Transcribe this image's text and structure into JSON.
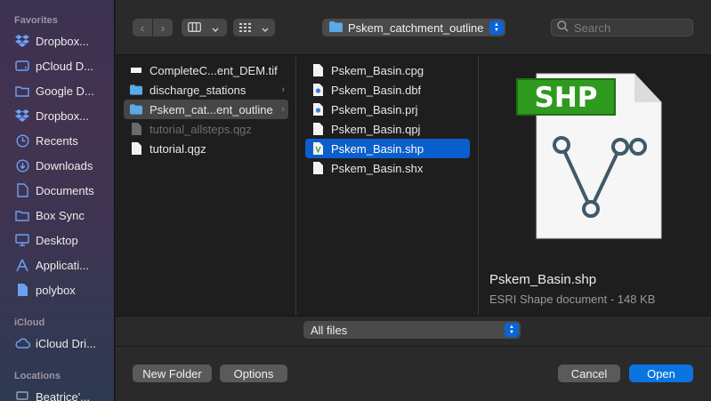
{
  "sidebar": {
    "sections": {
      "favorites": "Favorites",
      "icloud": "iCloud",
      "locations": "Locations"
    },
    "favorites": [
      {
        "label": "Dropbox...",
        "icon": "dropbox-icon"
      },
      {
        "label": "pCloud D...",
        "icon": "drive-icon"
      },
      {
        "label": "Google D...",
        "icon": "folder-icon"
      },
      {
        "label": "Dropbox...",
        "icon": "dropbox-icon"
      },
      {
        "label": "Recents",
        "icon": "clock-icon"
      },
      {
        "label": "Downloads",
        "icon": "download-icon"
      },
      {
        "label": "Documents",
        "icon": "document-icon"
      },
      {
        "label": "Box Sync",
        "icon": "folder-icon"
      },
      {
        "label": "Desktop",
        "icon": "desktop-icon"
      },
      {
        "label": "Applicati...",
        "icon": "applications-icon"
      },
      {
        "label": "polybox",
        "icon": "file-icon"
      }
    ],
    "icloud": [
      {
        "label": "iCloud Dri...",
        "icon": "cloud-icon"
      }
    ],
    "locations": [
      {
        "label": "Beatrice'...",
        "icon": "computer-icon"
      }
    ]
  },
  "toolbar": {
    "path_label": "Pskem_catchment_outline",
    "search_placeholder": "Search"
  },
  "columns": {
    "col1": [
      {
        "name": "CompleteC...ent_DEM.tif",
        "kind": "file",
        "state": "normal"
      },
      {
        "name": "discharge_stations",
        "kind": "folder",
        "state": "normal"
      },
      {
        "name": "Pskem_cat...ent_outline",
        "kind": "folder",
        "state": "selected-gray"
      },
      {
        "name": "tutorial_allsteps.qgz",
        "kind": "file",
        "state": "dim"
      },
      {
        "name": "tutorial.qgz",
        "kind": "file",
        "state": "normal"
      }
    ],
    "col2": [
      {
        "name": "Pskem_Basin.cpg",
        "kind": "file",
        "state": "normal"
      },
      {
        "name": "Pskem_Basin.dbf",
        "kind": "qgis-file",
        "state": "normal"
      },
      {
        "name": "Pskem_Basin.prj",
        "kind": "qgis-file",
        "state": "normal"
      },
      {
        "name": "Pskem_Basin.qpj",
        "kind": "file",
        "state": "normal"
      },
      {
        "name": "Pskem_Basin.shp",
        "kind": "shp-file",
        "state": "selected-blue"
      },
      {
        "name": "Pskem_Basin.shx",
        "kind": "file",
        "state": "normal"
      }
    ]
  },
  "preview": {
    "badge": "SHP",
    "name": "Pskem_Basin.shp",
    "description": "ESRI Shape document - 148 KB"
  },
  "bottom": {
    "filter_label": "All files",
    "new_folder": "New Folder",
    "options": "Options",
    "cancel": "Cancel",
    "open": "Open"
  },
  "colors": {
    "accent": "#0a74e0",
    "selection": "#0a5fcc",
    "shp_badge": "#2e9a1e"
  }
}
